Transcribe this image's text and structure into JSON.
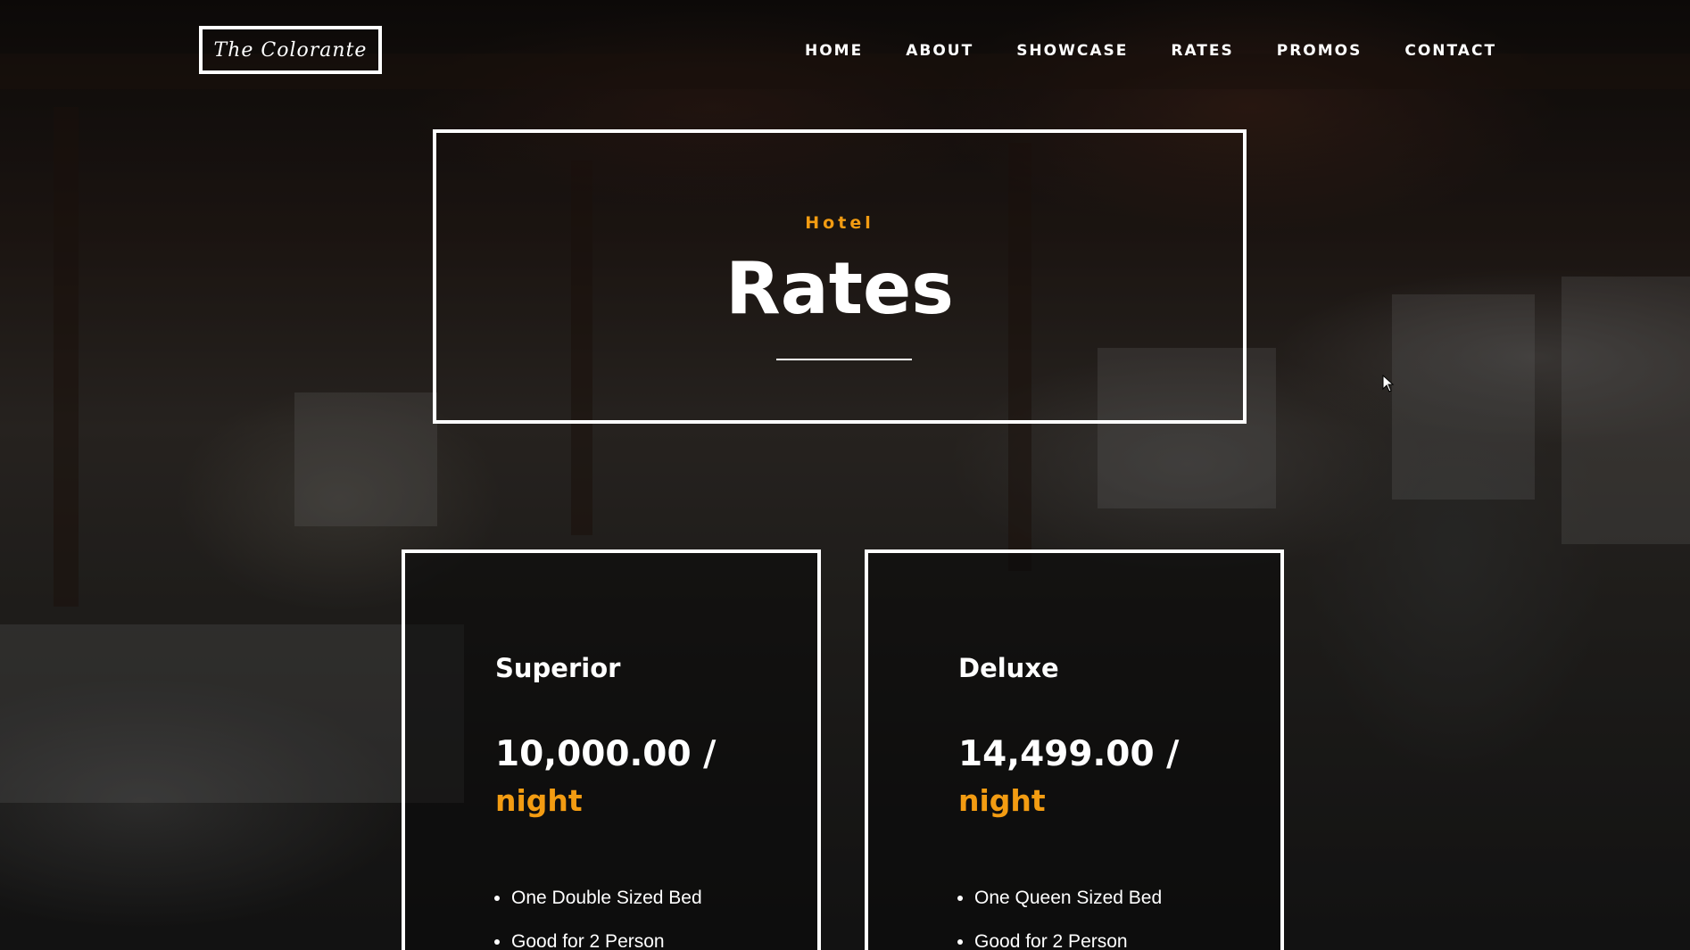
{
  "header": {
    "logo_text": "The Colorante",
    "nav": [
      {
        "label": "HOME"
      },
      {
        "label": "ABOUT"
      },
      {
        "label": "SHOWCASE"
      },
      {
        "label": "RATES"
      },
      {
        "label": "PROMOS"
      },
      {
        "label": "CONTACT"
      }
    ]
  },
  "hero": {
    "kicker": "Hotel",
    "title": "Rates"
  },
  "rates": [
    {
      "name": "Superior",
      "price": "10,000.00 /",
      "unit": "night",
      "features": [
        "One Double Sized Bed",
        "Good for 2 Person"
      ]
    },
    {
      "name": "Deluxe",
      "price": "14,499.00 /",
      "unit": "night",
      "features": [
        "One Queen Sized Bed",
        "Good for 2 Person"
      ]
    }
  ],
  "colors": {
    "accent": "#f39c12",
    "text": "#ffffff",
    "frame": "#ffffff"
  }
}
